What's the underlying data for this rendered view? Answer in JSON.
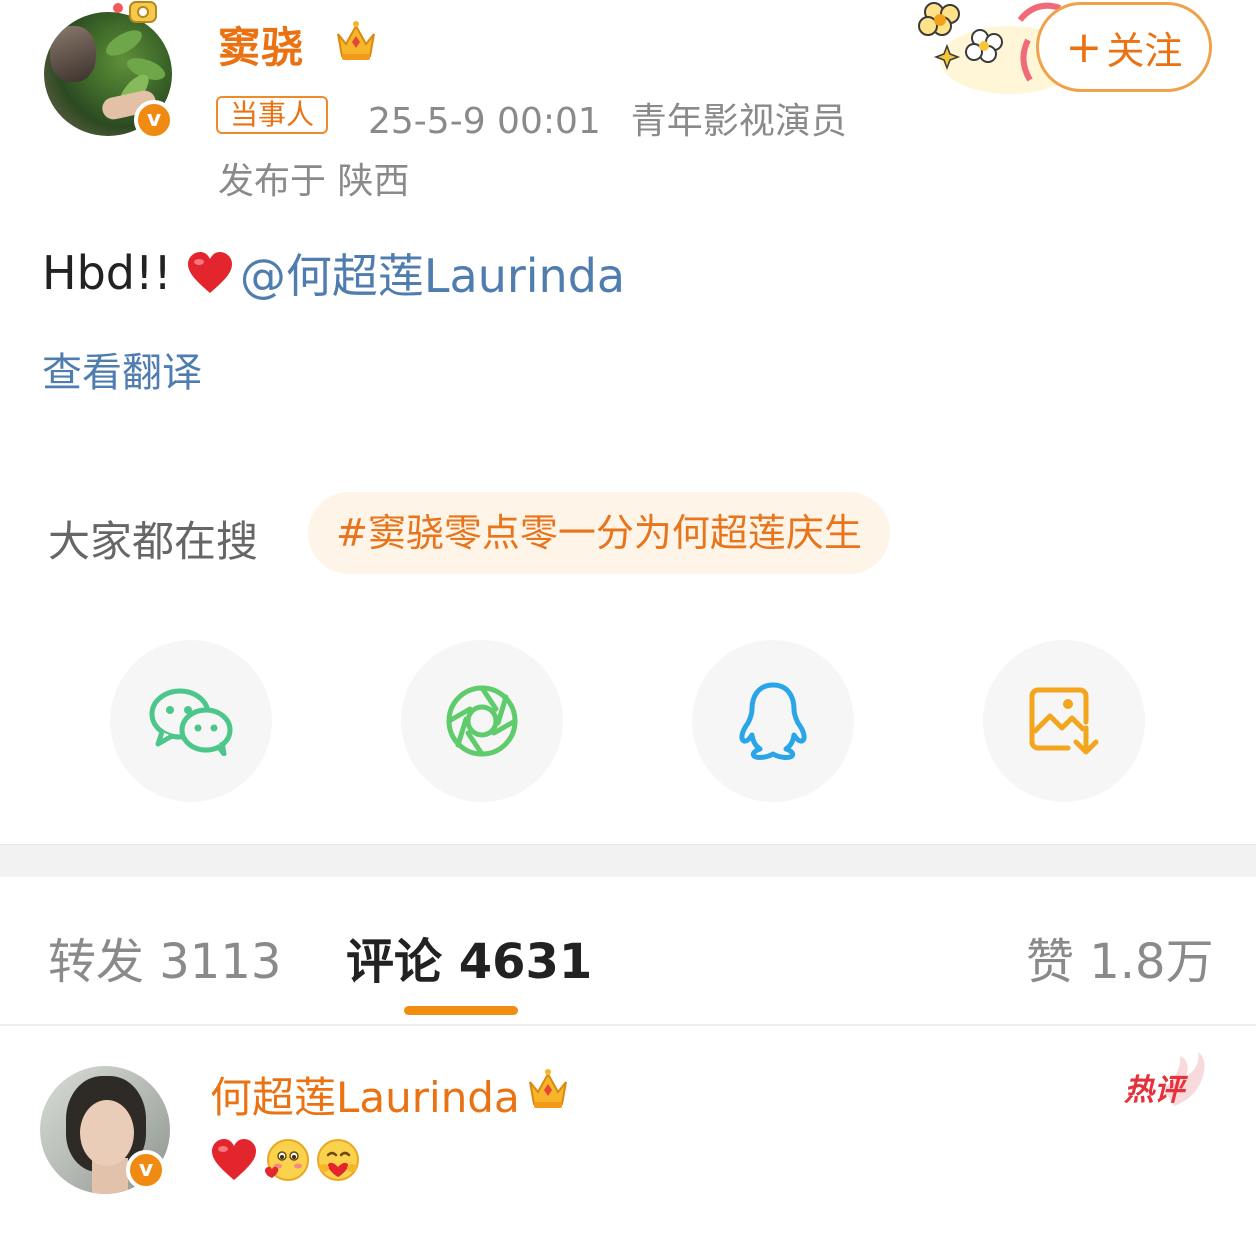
{
  "post": {
    "author": {
      "name": "窦骁",
      "verified_mark": "v",
      "crown_icon": "crown-icon"
    },
    "tag": "当事人",
    "timestamp": "25-5-9 00:01",
    "author_title": "青年影视演员",
    "location": "发布于 陕西",
    "follow_button": {
      "plus": "+",
      "label": "关注"
    },
    "text_prefix": "Hbd!!",
    "mention": "@何超莲Laurinda",
    "translate_link": "查看翻译"
  },
  "search": {
    "label": "大家都在搜",
    "topic": "#窦骁零点零一分为何超莲庆生"
  },
  "share": {
    "items": [
      {
        "name": "wechat-icon",
        "color": "#4cc68a"
      },
      {
        "name": "moments-icon",
        "color": "#5fcb6b"
      },
      {
        "name": "qq-icon",
        "color": "#2aa6e8"
      },
      {
        "name": "save-image-icon",
        "color": "#f2a51d"
      }
    ]
  },
  "tabs": {
    "repost": "转发 3113",
    "comments": "评论 4631",
    "likes": "赞 1.8万",
    "active": "comments",
    "accent_color": "#f18e12"
  },
  "comment": {
    "author": "何超莲Laurinda",
    "verified_mark": "v",
    "hot_badge": "热评"
  }
}
